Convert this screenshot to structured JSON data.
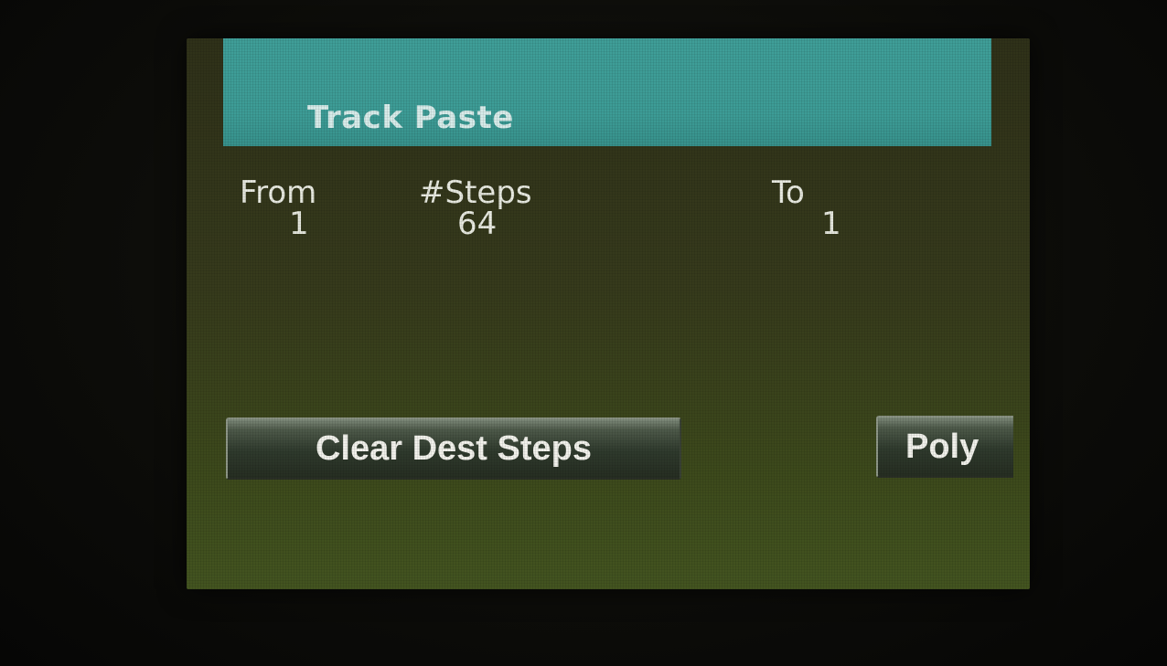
{
  "header": {
    "title": "Track Paste"
  },
  "params": {
    "from": {
      "label": "From",
      "value": "1"
    },
    "steps": {
      "label": "#Steps",
      "value": "64"
    },
    "to": {
      "label": "To",
      "value": "1"
    }
  },
  "buttons": {
    "clear_dest_steps": "Clear Dest Steps",
    "poly": "Poly"
  },
  "colors": {
    "title_bar": "#3d9c96",
    "screen_bg": "#363a1c",
    "text": "#e9ebe2"
  }
}
